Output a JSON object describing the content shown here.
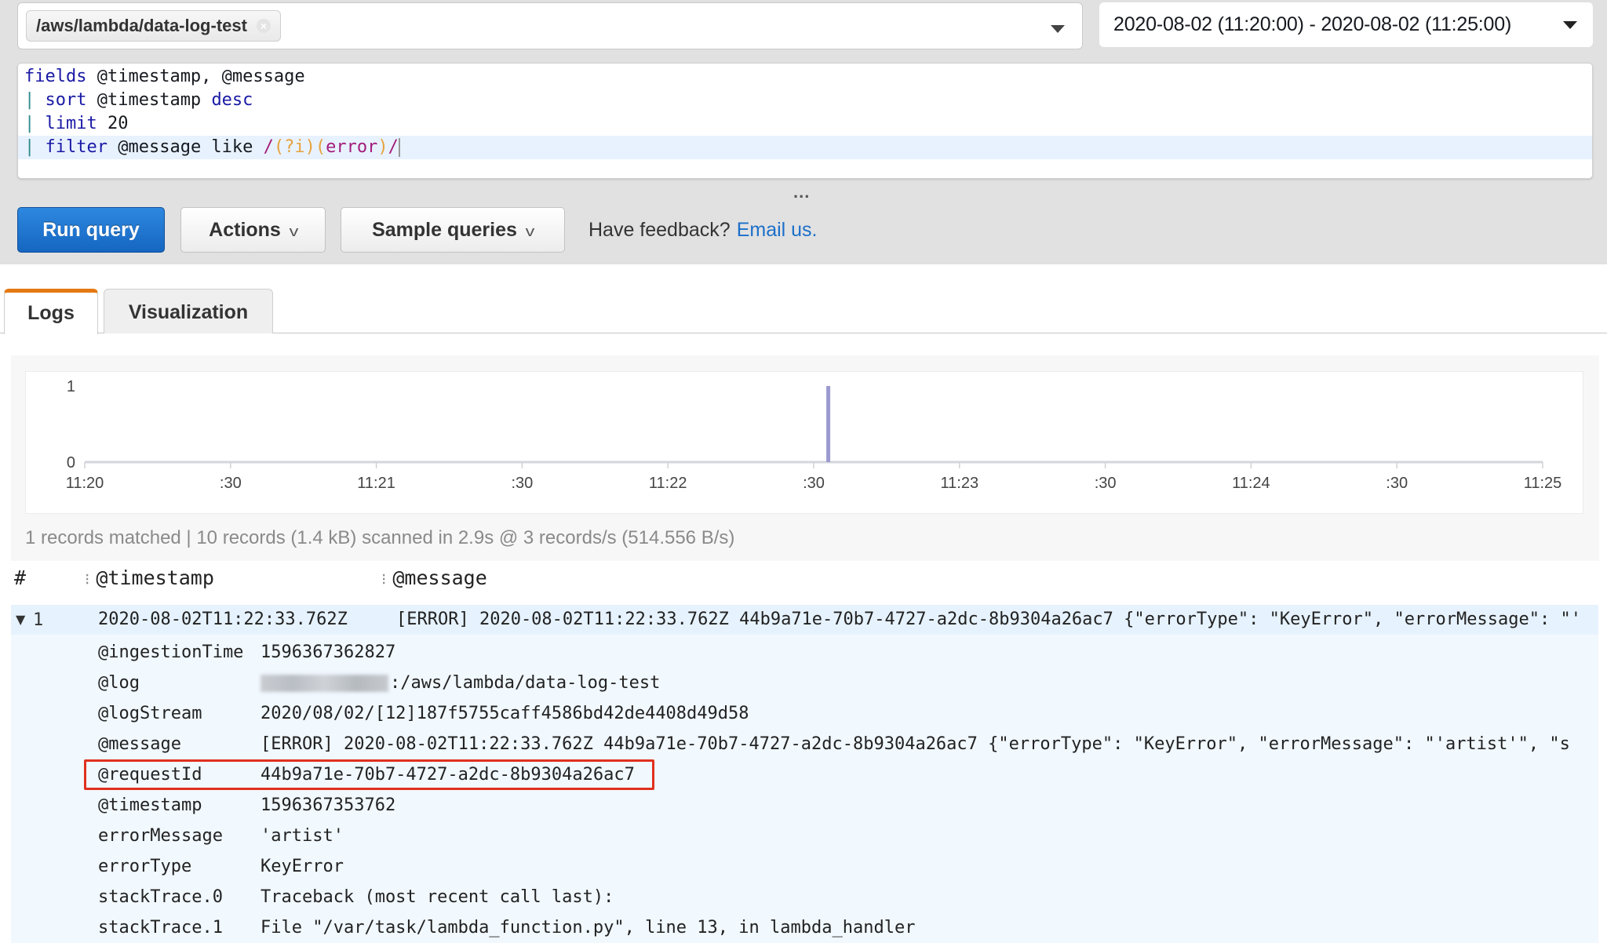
{
  "query_bar": {
    "log_group_token": "/aws/lambda/data-log-test",
    "token_remove_icon": "close-circle-icon",
    "log_group_dropdown_icon": "caret-down-icon",
    "time_range": "2020-08-02 (11:20:00) - 2020-08-02 (11:25:00)",
    "time_range_dropdown_icon": "caret-down-icon"
  },
  "editor": {
    "lines": [
      {
        "pipe": "",
        "cmd": "fields",
        "rest": " @timestamp, @message"
      },
      {
        "pipe": "| ",
        "cmd": "sort",
        "rest": " @timestamp ",
        "tail_kw": "desc"
      },
      {
        "pipe": "| ",
        "cmd": "limit",
        "rest": " 20"
      },
      {
        "pipe": "| ",
        "cmd": "filter",
        "rest": " @message like ",
        "regex_open": "/",
        "regex_group1": "(?i)",
        "regex_group2_open": "(",
        "regex_word": "error",
        "regex_group2_close": ")",
        "regex_close": "/"
      }
    ],
    "resize_handle": "..."
  },
  "toolbar": {
    "run_query": "Run query",
    "actions": "Actions",
    "sample_queries": "Sample queries",
    "feedback_text": "Have feedback?",
    "feedback_link": "Email us."
  },
  "tabs": [
    {
      "label": "Logs",
      "active": true
    },
    {
      "label": "Visualization",
      "active": false
    }
  ],
  "chart_data": {
    "type": "bar",
    "title": "",
    "xlabel": "",
    "ylabel": "",
    "x_ticks": [
      "11:20",
      ":30",
      "11:21",
      ":30",
      "11:22",
      ":30",
      "11:23",
      ":30",
      "11:24",
      ":30",
      "11:25"
    ],
    "y_ticks": [
      "0",
      "1"
    ],
    "ylim": [
      0,
      1
    ],
    "xlim_seconds": [
      0,
      300
    ],
    "series": [
      {
        "name": "records",
        "color": "#9b9bd0",
        "points": [
          {
            "x_seconds": 153,
            "x_label": "11:22:33",
            "value": 1
          }
        ]
      }
    ],
    "grid": false,
    "legend": "none"
  },
  "summary": "1 records matched | 10 records (1.4 kB) scanned in 2.9s @ 3 records/s (514.556 B/s)",
  "table": {
    "columns": [
      "#",
      "@timestamp",
      "@message"
    ],
    "rows": [
      {
        "index": "1",
        "expanded": true,
        "timestamp": "2020-08-02T11:22:33.762Z",
        "message": "[ERROR] 2020-08-02T11:22:33.762Z 44b9a71e-70b7-4727-a2dc-8b9304a26ac7 {\"errorType\": \"KeyError\", \"errorMessage\": \"'",
        "fields": [
          {
            "key": "@ingestionTime",
            "value": "1596367362827"
          },
          {
            "key": "@log",
            "value": ":/aws/lambda/data-log-test",
            "redacted_prefix": true
          },
          {
            "key": "@logStream",
            "value": "2020/08/02/[12]187f5755caff4586bd42de4408d49d58"
          },
          {
            "key": "@message",
            "value": "[ERROR] 2020-08-02T11:22:33.762Z 44b9a71e-70b7-4727-a2dc-8b9304a26ac7 {\"errorType\": \"KeyError\", \"errorMessage\": \"'artist'\", \"s"
          },
          {
            "key": "@requestId",
            "value": "44b9a71e-70b7-4727-a2dc-8b9304a26ac7",
            "highlighted": true
          },
          {
            "key": "@timestamp",
            "value": "1596367353762"
          },
          {
            "key": "errorMessage",
            "value": "'artist'"
          },
          {
            "key": "errorType",
            "value": "KeyError"
          },
          {
            "key": "stackTrace.0",
            "value": "Traceback (most recent call last):"
          },
          {
            "key": "stackTrace.1",
            "value": "File \"/var/task/lambda_function.py\", line 13, in lambda_handler"
          }
        ]
      }
    ]
  },
  "colors": {
    "primary_button": "#1a73c9",
    "active_tab_accent": "#e47911",
    "highlight_box": "#e0301e",
    "link": "#1c6fc9",
    "bar": "#9b9bd0"
  }
}
